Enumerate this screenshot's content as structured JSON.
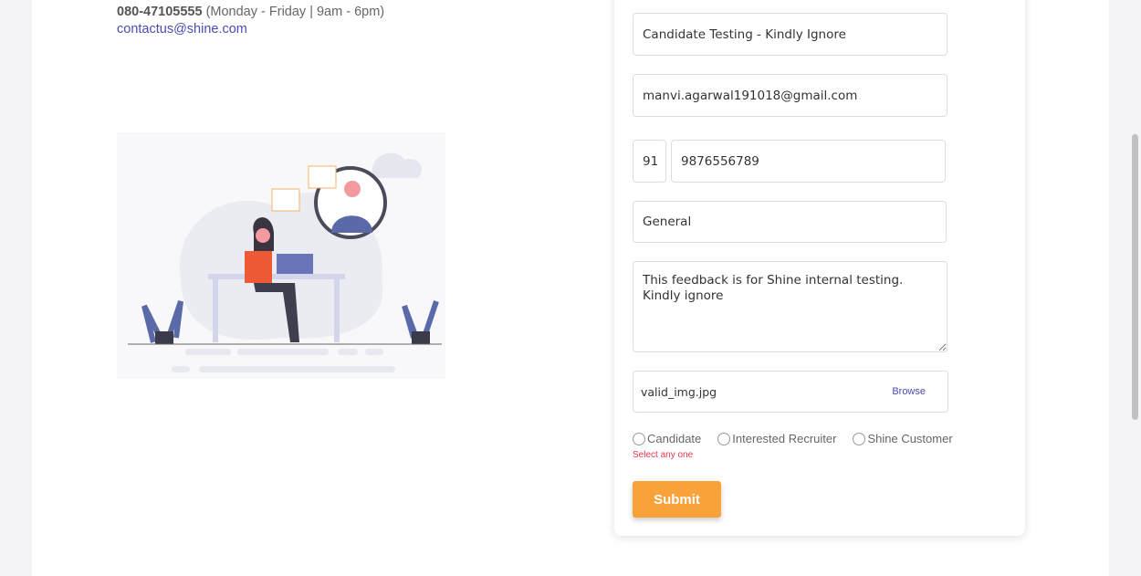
{
  "contact": {
    "phone": "080-47105555",
    "hours": "(Monday - Friday | 9am - 6pm)",
    "email": "contactus@shine.com"
  },
  "form": {
    "subject": "Candidate Testing - Kindly Ignore",
    "email": "manvi.agarwal191018@gmail.com",
    "country_code": "91",
    "mobile": "9876556789",
    "category": "General",
    "message": "This feedback is for Shine internal testing. Kindly ignore",
    "file_name": "valid_img.jpg",
    "browse_label": "Browse",
    "radios": [
      {
        "label": "Candidate"
      },
      {
        "label": "Interested Recruiter"
      },
      {
        "label": "Shine Customer"
      }
    ],
    "error": "Select any one",
    "submit_label": "Submit"
  },
  "colors": {
    "accent": "#f9a23a",
    "link": "#4b4bb5",
    "error": "#e8384f"
  }
}
